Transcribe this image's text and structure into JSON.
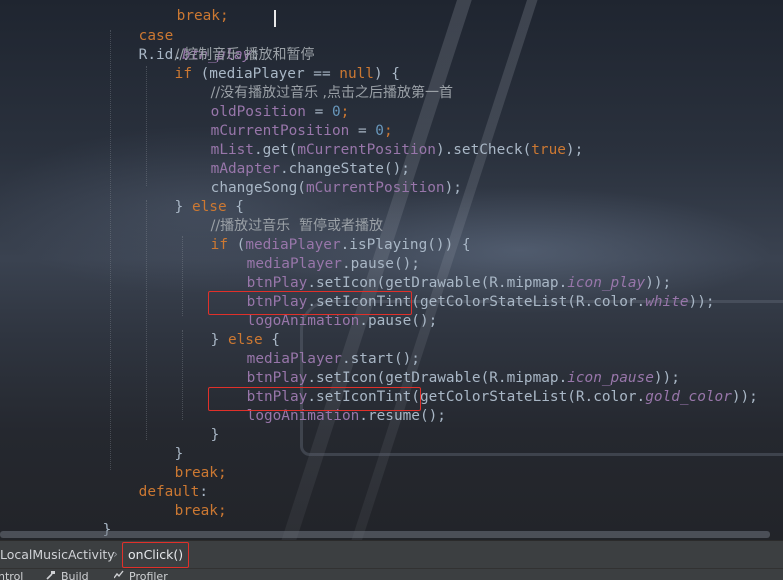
{
  "code": {
    "top_partial": "break;",
    "case_kw": "case",
    "case_ref": "R.id.",
    "case_id": "btn_play",
    "case_colon": ":",
    "comment1": "//控制音乐 播放和暂停",
    "if_kw": "if",
    "if_cond_open": " (mediaPlayer == ",
    "null_kw": "null",
    "if_cond_close": ") {",
    "comment2": "//没有播放过音乐 ,点击之后播放第一首",
    "old_pos_var": "oldPosition",
    "assign_eq": " = ",
    "zero": "0",
    "semicolon": ";",
    "cur_pos_var": "mCurrentPosition",
    "mlist_var": "mList",
    "get_call": ".get(",
    "set_check_call": ").setCheck(",
    "true_kw": "true",
    "call_close": ");",
    "adapter_var": "mAdapter",
    "change_state_call": ".changeState();",
    "change_song_call": "changeSong(",
    "else_open_close": "} ",
    "else_kw": "else",
    "brace_open": " {",
    "comment3": "//播放过音乐  暂停或者播放",
    "is_playing_open": " (",
    "media_player_var": "mediaPlayer",
    "is_playing_call": ".isPlaying()) {",
    "pause_call": ".pause();",
    "btn_play_var": "btnPlay",
    "set_icon_call": ".setIcon(getDrawable(R.mipmap.",
    "icon_play": "icon_play",
    "double_close": "));",
    "set_icon_tint_call": ".setIconTint(getColorStateList(R.color.",
    "white": "white",
    "logo_anim_var": "logoAnimation",
    "start_call": ".start();",
    "icon_pause": "icon_pause",
    "gold_color": "gold_color",
    "resume_call": ".resume();",
    "brace_close": "}",
    "break_kw": "break",
    "default_kw": "default",
    "colon": ":"
  },
  "breadcrumb": {
    "class_name": "LocalMusicActivity",
    "separator": "›",
    "method_name": "onClick()"
  },
  "toolbar": {
    "control_label": "ntrol",
    "build_label": "Build",
    "profiler_label": "Profiler"
  },
  "colors": {
    "keyword": "#cc7832",
    "field": "#9876aa",
    "number": "#6897bb",
    "default_text": "#a9b7c6",
    "comment": "#9aa0a6",
    "highlight_box": "#e0302a"
  }
}
